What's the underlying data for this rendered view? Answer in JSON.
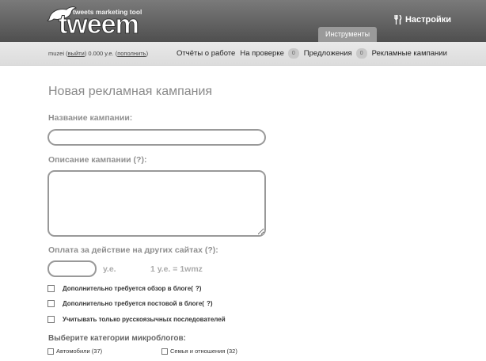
{
  "header": {
    "logo_tagline": "tweets marketing tool",
    "logo_word": "tweem",
    "settings_label": "Настройки",
    "settings_icon": "fork-knife-icon",
    "tools_tab": "Инструменты"
  },
  "account": {
    "username": "muzei",
    "logout": "выйти",
    "balance": "0.000 у.е.",
    "topup": "пополнить"
  },
  "nav": {
    "reports": "Отчёты о работе",
    "review": "На проверке",
    "review_count": "0",
    "offers": "Предложения",
    "offers_count": "0",
    "campaigns": "Рекламные кампании"
  },
  "form": {
    "title": "Новая рекламная кампания",
    "name_label": "Название кампании:",
    "name_value": "",
    "desc_label": "Описание кампании",
    "help": "?",
    "desc_value": "",
    "pay_label": "Оплата за действие на других сайтах",
    "pay_value": "",
    "currency": "у.е.",
    "rate": "1 у.е. = 1wmz",
    "check1": "Дополнительно требуется обзор в блоге",
    "check2": "Дополнительно требуется постовой в блоге",
    "check3": "Учитывать только русскоязычных последователей",
    "categories_label": "Выберите категории микроблогов:",
    "categories": [
      {
        "label": "Автомобили (37)"
      },
      {
        "label": "Семья и отношения (32)"
      }
    ]
  }
}
